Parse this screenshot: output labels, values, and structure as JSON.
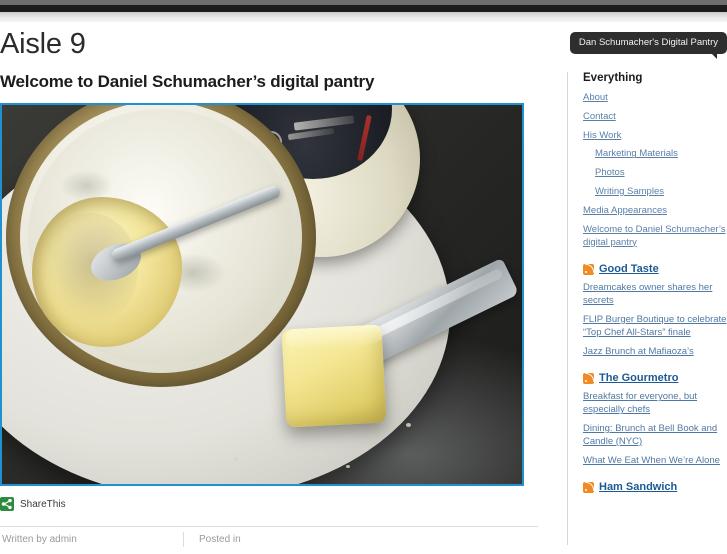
{
  "chrome": {
    "present": true
  },
  "header": {
    "site_title": "Aisle 9",
    "tagline_badge": "Dan Schumacher's Digital Pantry"
  },
  "post": {
    "title": "Welcome to Daniel Schumacher’s digital pantry",
    "image_alt": "Camembert cheese in a wooden box with spoon, knife and butter cube on a white plate",
    "image_border_color": "#2190cf",
    "share": {
      "icon": "sharethis-icon",
      "label": "ShareThis",
      "icon_color": "#2e8b3d"
    },
    "meta": {
      "author_text": "Written by admin",
      "posted_in_text": "Posted in"
    }
  },
  "sidebar": {
    "heading": "Everything",
    "nav": [
      {
        "label": "About",
        "sub": false
      },
      {
        "label": "Contact",
        "sub": false
      },
      {
        "label": "His Work",
        "sub": false
      },
      {
        "label": "Marketing Materials",
        "sub": true
      },
      {
        "label": "Photos",
        "sub": true
      },
      {
        "label": "Writing Samples",
        "sub": true
      },
      {
        "label": "Media Appearances",
        "sub": false
      },
      {
        "label": "Welcome to Daniel Schumacher’s digital pantry",
        "sub": false
      }
    ],
    "feeds": [
      {
        "name": "Good Taste",
        "icon": "rss-icon",
        "items": [
          "Dreamcakes owner shares her secrets",
          "FLIP Burger Boutique to celebrate “Top Chef All-Stars” finale",
          "Jazz Brunch at Mafiaoza’s"
        ]
      },
      {
        "name": "The Gourmetro",
        "icon": "rss-icon",
        "items": [
          "Breakfast for everyone, but especially chefs",
          "Dining: Brunch at Bell Book and Candle (NYC)",
          "What We Eat When We’re Alone"
        ]
      },
      {
        "name": "Ham Sandwich",
        "icon": "rss-icon",
        "items": []
      }
    ]
  },
  "colors": {
    "link": "#5a80a8",
    "feed_heading": "#1d5a94",
    "rss_orange": "#f08a24",
    "image_border": "#2190cf",
    "badge_bg": "#2e2e2e"
  }
}
